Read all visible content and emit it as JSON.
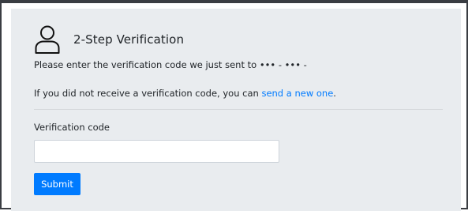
{
  "verification": {
    "title": "2-Step Verification",
    "instruction_prefix": "Please enter the verification code we just sent to ",
    "masked_destination": "••• - ••• -",
    "resend_prefix": "If you did not receive a verification code, you can ",
    "resend_link": "send a new one",
    "resend_suffix": "."
  },
  "form": {
    "code_label": "Verification code",
    "code_value": "",
    "code_placeholder": "",
    "submit_label": "Submit"
  },
  "icons": {
    "header_icon": "user-icon"
  },
  "colors": {
    "card_background": "#e9ecef",
    "primary": "#007bff",
    "text": "#212529",
    "frame_border": "#3a3d42"
  }
}
